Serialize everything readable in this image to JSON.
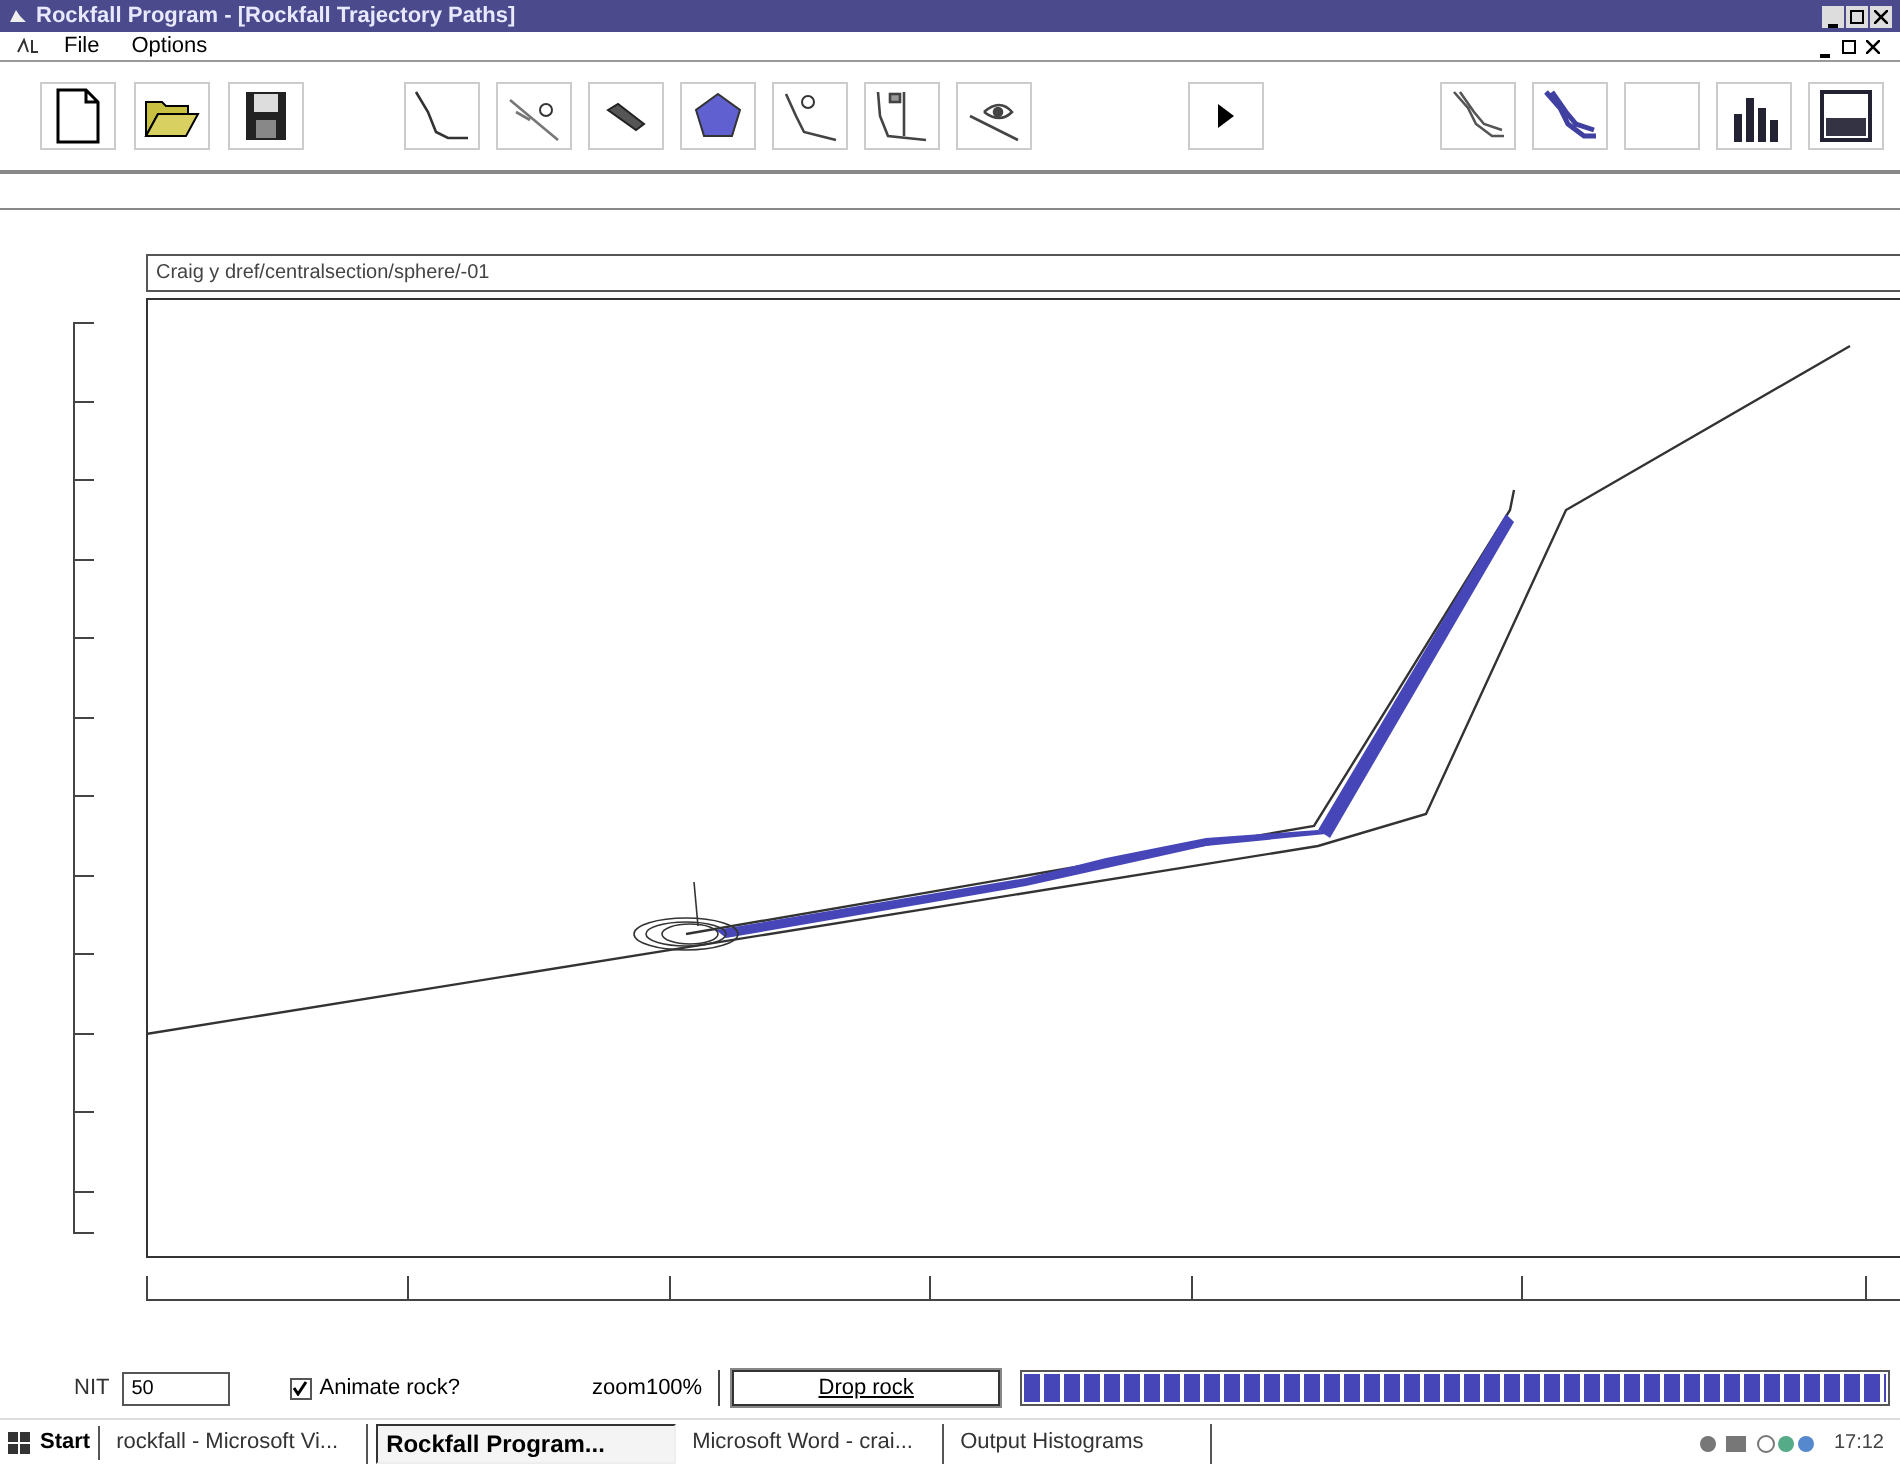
{
  "window": {
    "title": "Rockfall Program - [Rockfall Trajectory Paths]"
  },
  "menu": [
    {
      "label": "File"
    },
    {
      "label": "Options"
    }
  ],
  "plot": {
    "label": "Craig y dref/centralsection/sphere/-01"
  },
  "controls": {
    "nit_label": "NIT",
    "nit_value": "50",
    "animate": {
      "label": "Animate rock?",
      "checked": true
    },
    "zoom_button": "zoom100%",
    "drop_button": "Drop rock",
    "progress": {
      "level": 1
    }
  },
  "taskbar": {
    "start": "Start",
    "tasks": [
      {
        "label": "rockfall - Microsoft Vi...",
        "selected": false
      },
      {
        "label": "Rockfall Program...",
        "selected": true
      },
      {
        "label": "Microsoft Word - crai...",
        "selected": false
      },
      {
        "label": "Output Histograms",
        "selected": false
      }
    ],
    "clock": "17:12"
  }
}
